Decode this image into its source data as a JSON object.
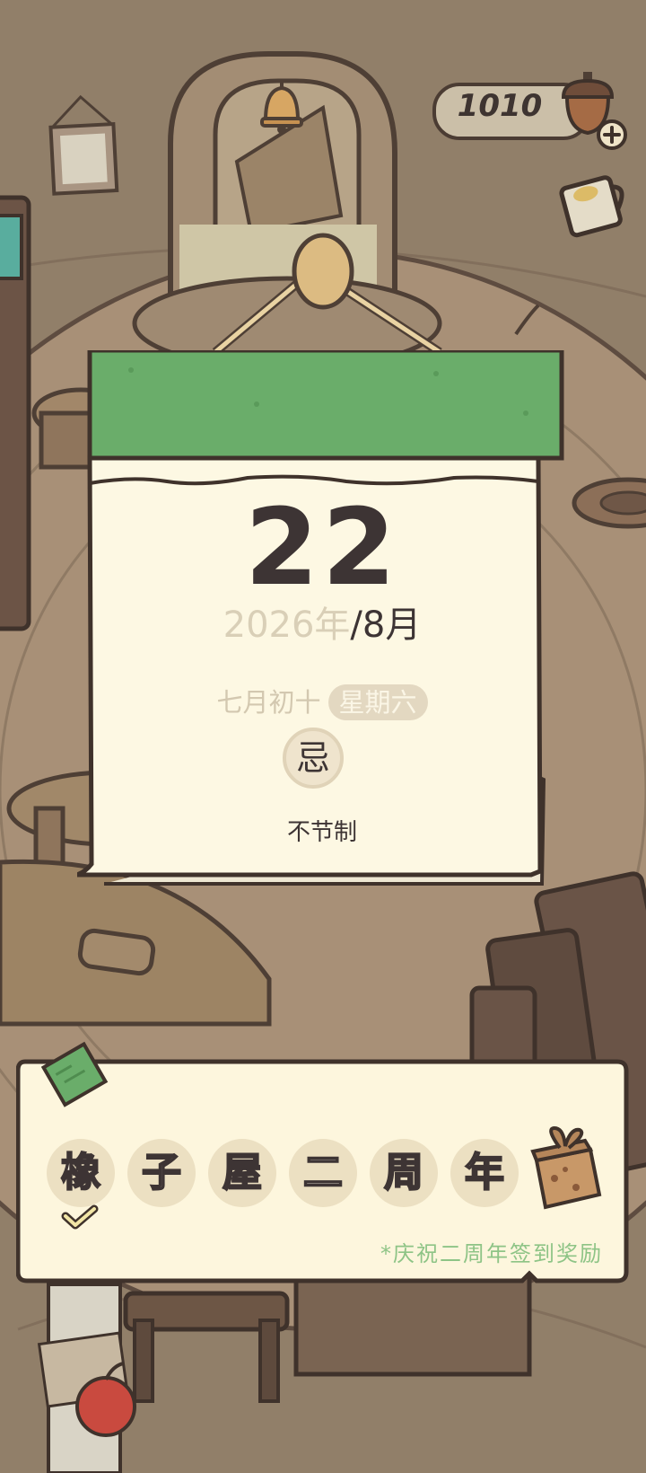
{
  "currency": {
    "amount": "1010",
    "icon": "acorn-icon",
    "add_icon": "plus-icon"
  },
  "calendar": {
    "day": "22",
    "year": "2026年",
    "month": "/8月",
    "lunar_date": "七月初十",
    "weekday": "星期六",
    "avoid_mark": "忌",
    "avoid_text": "不节制",
    "header_color": "#6aad6a",
    "paper_color": "#fdf8e3"
  },
  "signin": {
    "characters": [
      "橡",
      "子",
      "屋",
      "二",
      "周",
      "年"
    ],
    "checked_count": 1,
    "note": "*庆祝二周年签到奖励",
    "reward_icon": "gift-box-icon"
  },
  "colors": {
    "accent_green": "#6aad6a",
    "note_green": "#8ec486",
    "ink": "#3d3434"
  }
}
